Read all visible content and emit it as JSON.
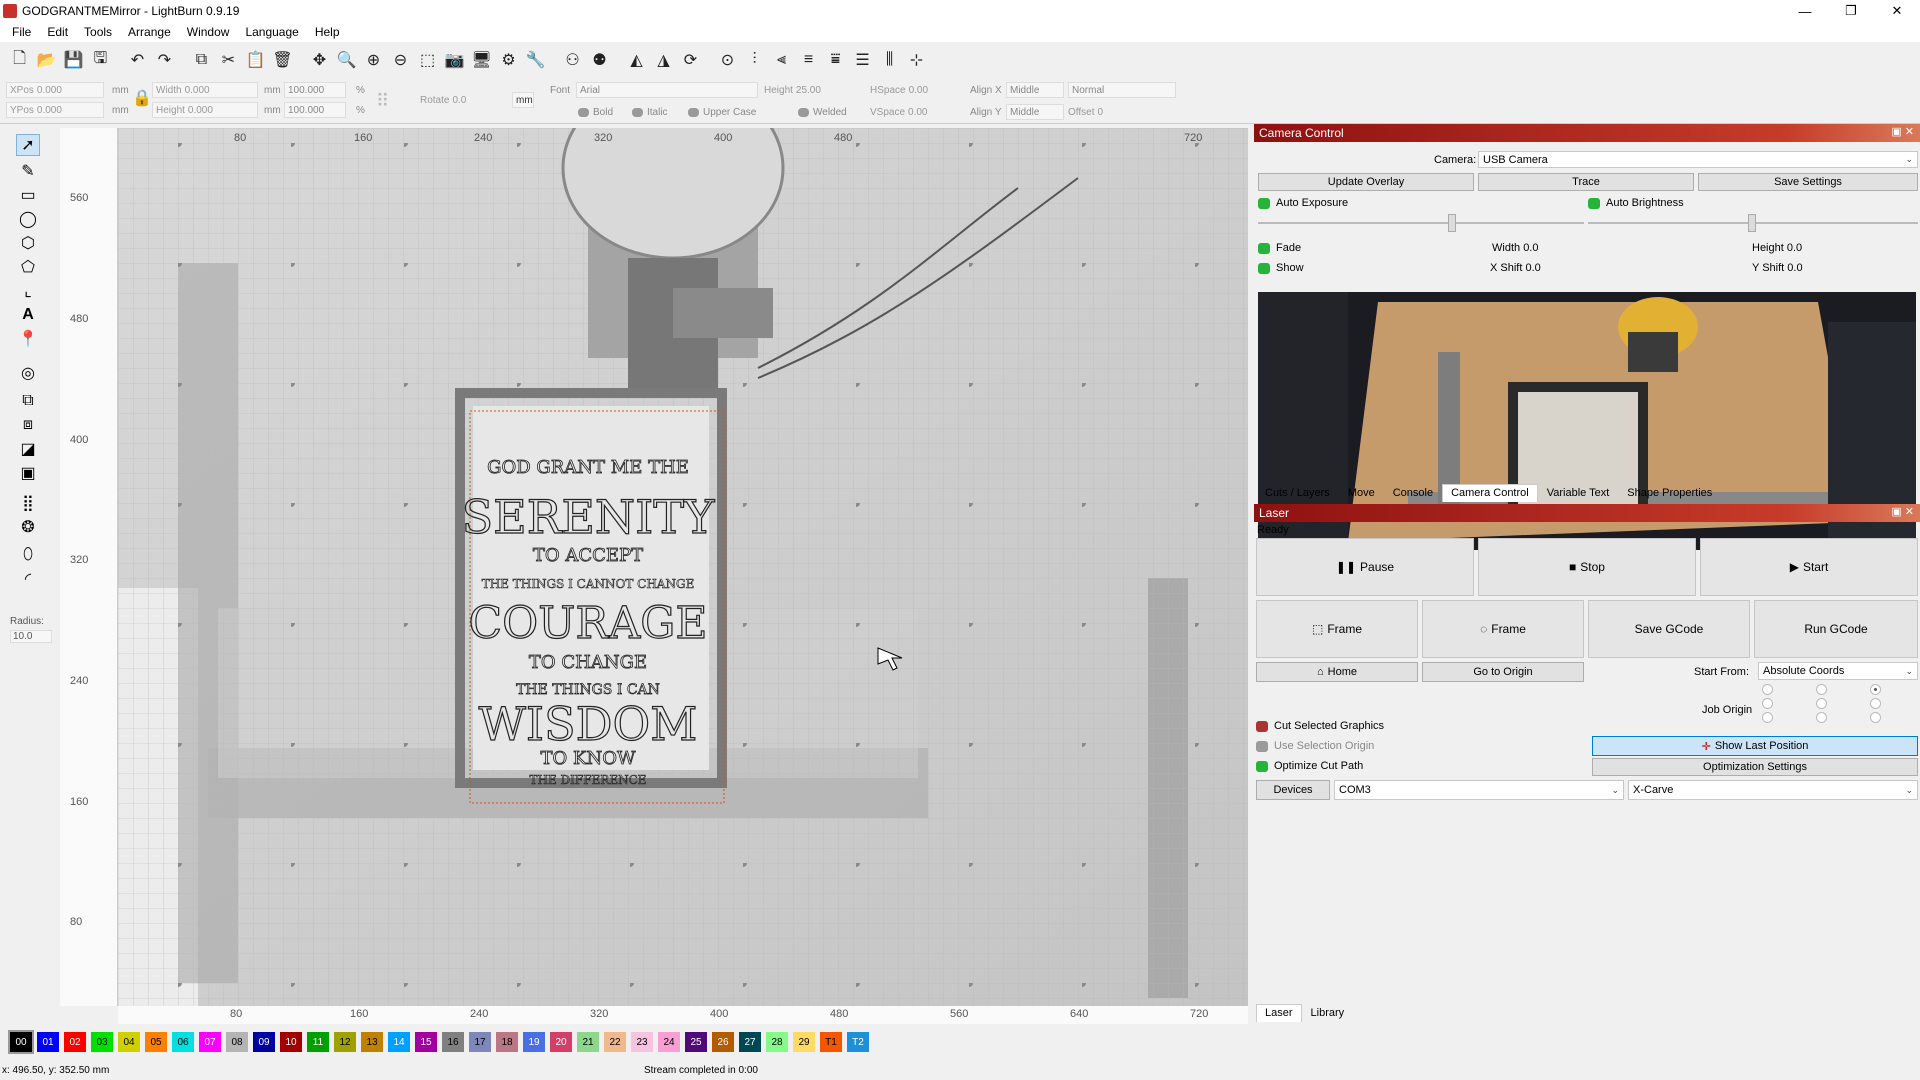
{
  "window": {
    "title": "GODGRANTMEMirror - LightBurn 0.9.19",
    "min": "—",
    "max": "❐",
    "close": "✕"
  },
  "menu": [
    "File",
    "Edit",
    "Tools",
    "Arrange",
    "Window",
    "Language",
    "Help"
  ],
  "toolbar_icons": [
    "new-file",
    "open-folder",
    "save",
    "save-as",
    "undo",
    "redo",
    "copy",
    "cut",
    "paste",
    "delete",
    "move",
    "zoom-in",
    "zoom-plus",
    "zoom-minus",
    "zoom-select",
    "camera",
    "monitor",
    "settings",
    "tools",
    "group",
    "ungroup",
    "mirror-h",
    "mirror-v",
    "rotate",
    "center",
    "align-1",
    "align-2",
    "distribute-1",
    "distribute-2",
    "distribute-3",
    "distribute-4",
    "dock"
  ],
  "props": {
    "xpos_label": "XPos",
    "xpos": "0.000",
    "ypos_label": "YPos",
    "ypos": "0.000",
    "mm": "mm",
    "width_label": "Width",
    "width": "0.000",
    "height_label": "Height",
    "height": "0.000",
    "scale_w": "100.000",
    "scale_h": "100.000",
    "percent": "%",
    "rotate_label": "Rotate",
    "rotate": "0.0",
    "unit_btn": "mm",
    "font_label": "Font",
    "font": "Arial",
    "fheight_label": "Height",
    "fheight": "25.00",
    "hspace_label": "HSpace",
    "hspace": "0.00",
    "vspace_label": "VSpace",
    "vspace": "0.00",
    "alignx_label": "Align X",
    "alignx": "Middle",
    "aligny_label": "Align Y",
    "aligny": "Middle",
    "normal": "Normal",
    "offset_label": "Offset",
    "offset": "0",
    "bold": "Bold",
    "italic": "Italic",
    "upper": "Upper Case",
    "welded": "Welded"
  },
  "left_tools": {
    "radius_label": "Radius:",
    "radius": "10.0"
  },
  "ruler": {
    "v": [
      "560",
      "480",
      "400",
      "320",
      "240",
      "160",
      "80"
    ],
    "h": [
      "80",
      "160",
      "240",
      "320",
      "400",
      "480",
      "560",
      "640",
      "720"
    ]
  },
  "camera_panel": {
    "title": "Camera Control",
    "camera_label": "Camera:",
    "camera": "USB Camera",
    "update_overlay": "Update Overlay",
    "trace": "Trace",
    "save_settings": "Save Settings",
    "auto_exposure": "Auto Exposure",
    "auto_brightness": "Auto Brightness",
    "fade": "Fade",
    "show": "Show",
    "width_label": "Width",
    "width": "0.0",
    "height_label": "Height",
    "height": "0.0",
    "xshift_label": "X Shift",
    "xshift": "0.0",
    "yshift_label": "Y Shift",
    "yshift": "0.0"
  },
  "panel_tabs": [
    "Cuts / Layers",
    "Move",
    "Console",
    "Camera Control",
    "Variable Text",
    "Shape Properties"
  ],
  "laser_panel": {
    "title": "Laser",
    "status": "Ready",
    "pause": "Pause",
    "stop": "Stop",
    "start": "Start",
    "frame1": "Frame",
    "frame2": "Frame",
    "save_gcode": "Save GCode",
    "run_gcode": "Run GCode",
    "home": "Home",
    "go_origin": "Go to Origin",
    "start_from_label": "Start From:",
    "start_from": "Absolute Coords",
    "job_origin_label": "Job Origin",
    "cut_selected": "Cut Selected Graphics",
    "use_sel_origin": "Use Selection Origin",
    "optimize_cut": "Optimize Cut Path",
    "show_last": "Show Last Position",
    "opt_settings": "Optimization Settings",
    "devices": "Devices",
    "port": "COM3",
    "machine": "X-Carve"
  },
  "bottom_tabs": [
    "Laser",
    "Library"
  ],
  "palette": [
    {
      "label": "00",
      "color": "#000000",
      "text": "#ffffff"
    },
    {
      "label": "01",
      "color": "#0000ff",
      "text": "#ffffff"
    },
    {
      "label": "02",
      "color": "#ff0000",
      "text": "#ffffff"
    },
    {
      "label": "03",
      "color": "#00e000",
      "text": "#000000"
    },
    {
      "label": "04",
      "color": "#d0d000",
      "text": "#000000"
    },
    {
      "label": "05",
      "color": "#ff8000",
      "text": "#000000"
    },
    {
      "label": "06",
      "color": "#00e0e0",
      "text": "#000000"
    },
    {
      "label": "07",
      "color": "#ff00ff",
      "text": "#ffffff"
    },
    {
      "label": "08",
      "color": "#b4b4b4",
      "text": "#000000"
    },
    {
      "label": "09",
      "color": "#0000a0",
      "text": "#ffffff"
    },
    {
      "label": "10",
      "color": "#a00000",
      "text": "#ffffff"
    },
    {
      "label": "11",
      "color": "#00a000",
      "text": "#ffffff"
    },
    {
      "label": "12",
      "color": "#a0a000",
      "text": "#000000"
    },
    {
      "label": "13",
      "color": "#c08000",
      "text": "#000000"
    },
    {
      "label": "14",
      "color": "#00a0ff",
      "text": "#ffffff"
    },
    {
      "label": "15",
      "color": "#a000a0",
      "text": "#ffffff"
    },
    {
      "label": "16",
      "color": "#808080",
      "text": "#000000"
    },
    {
      "label": "17",
      "color": "#7d87b9",
      "text": "#000000"
    },
    {
      "label": "18",
      "color": "#bb7784",
      "text": "#000000"
    },
    {
      "label": "19",
      "color": "#4a6fe3",
      "text": "#ffffff"
    },
    {
      "label": "20",
      "color": "#d33f6a",
      "text": "#ffffff"
    },
    {
      "label": "21",
      "color": "#8cd78c",
      "text": "#000000"
    },
    {
      "label": "22",
      "color": "#f0b98d",
      "text": "#000000"
    },
    {
      "label": "23",
      "color": "#f6c4e1",
      "text": "#000000"
    },
    {
      "label": "24",
      "color": "#fa9ed4",
      "text": "#000000"
    },
    {
      "label": "25",
      "color": "#500a78",
      "text": "#ffffff"
    },
    {
      "label": "26",
      "color": "#b45a00",
      "text": "#ffffff"
    },
    {
      "label": "27",
      "color": "#004754",
      "text": "#ffffff"
    },
    {
      "label": "28",
      "color": "#86fa88",
      "text": "#000000"
    },
    {
      "label": "29",
      "color": "#ffdb66",
      "text": "#000000"
    },
    {
      "label": "T1",
      "color": "#f35700",
      "text": "#000000"
    },
    {
      "label": "T2",
      "color": "#1e90d8",
      "text": "#ffffff"
    }
  ],
  "status": {
    "coords": "x: 496.50, y: 352.50 mm",
    "message": "Stream completed in 0:00"
  },
  "artwork": {
    "lines": [
      "GOD GRANT ME THE",
      "SERENITY",
      "TO ACCEPT",
      "THE THINGS I CANNOT CHANGE",
      "COURAGE",
      "TO CHANGE",
      "THE THINGS I CAN",
      "WISDOM",
      "TO KNOW",
      "THE DIFFERENCE"
    ]
  }
}
